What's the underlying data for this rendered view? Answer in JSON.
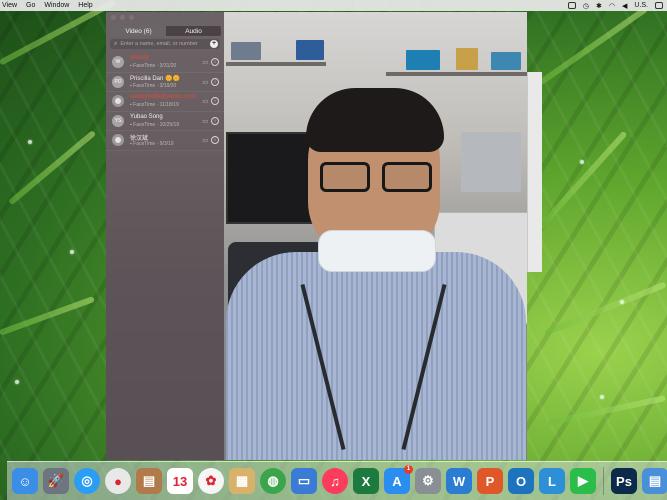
{
  "menubar": {
    "apple": "",
    "items": [
      "View",
      "Go",
      "Window",
      "Help"
    ],
    "right_status": "U.S."
  },
  "facetime": {
    "tabs": {
      "video": "Video (6)",
      "audio": "Audio"
    },
    "search_placeholder": "Enter a name, email, or number",
    "add_label": "+",
    "contacts": [
      {
        "avatar": "W",
        "name": "Wendy",
        "name_red": true,
        "sub": "FaceTime · 3/31/20"
      },
      {
        "avatar": "PD",
        "name": "Priscilla Dan 🌼🌼",
        "name_red": false,
        "sub": "FaceTime · 3/19/20"
      },
      {
        "avatar": "",
        "name": "wendyfw88@yahoo.com",
        "name_red": true,
        "sub": "FaceTime · 11/18/19"
      },
      {
        "avatar": "YS",
        "name": "Yubao Song",
        "name_red": false,
        "sub": "FaceTime · 10/25/19"
      },
      {
        "avatar": "",
        "name": "徐汉斌",
        "name_red": false,
        "sub": "FaceTime · 9/3/19"
      }
    ]
  },
  "dock": {
    "apps": [
      {
        "name": "Finder",
        "icon": "finder-icon",
        "color": "#3a8ee6",
        "glyph": "☺"
      },
      {
        "name": "Launchpad",
        "icon": "rocket-icon",
        "color": "#6d7680",
        "glyph": "🚀"
      },
      {
        "name": "Safari",
        "icon": "compass-icon",
        "color": "#2a9df4",
        "glyph": "◎"
      },
      {
        "name": "Chrome",
        "icon": "chrome-icon",
        "color": "#e8e8e8",
        "glyph": "●"
      },
      {
        "name": "Notefile",
        "icon": "notebook-icon",
        "color": "#b07a4a",
        "glyph": "▤"
      },
      {
        "name": "Calendar",
        "icon": "calendar-icon",
        "color": "#ffffff",
        "glyph": "13"
      },
      {
        "name": "Photos",
        "icon": "photos-icon",
        "color": "#f5f5f5",
        "glyph": "✿"
      },
      {
        "name": "Preview",
        "icon": "preview-icon",
        "color": "#d8b16a",
        "glyph": "▦"
      },
      {
        "name": "Globe",
        "icon": "globe-icon",
        "color": "#3aa54a",
        "glyph": "◍"
      },
      {
        "name": "Keynote",
        "icon": "keynote-icon",
        "color": "#3a7bd5",
        "glyph": "▭"
      },
      {
        "name": "Music",
        "icon": "music-icon",
        "color": "#fb3c5c",
        "glyph": "♫"
      },
      {
        "name": "Excel",
        "icon": "excel-icon",
        "color": "#1d7a3e",
        "glyph": "X"
      },
      {
        "name": "App Store",
        "icon": "appstore-icon",
        "color": "#2a8df0",
        "glyph": "A",
        "badge": "1"
      },
      {
        "name": "System Preferences",
        "icon": "gear-icon",
        "color": "#8a8f96",
        "glyph": "⚙"
      },
      {
        "name": "Word",
        "icon": "word-icon",
        "color": "#2b7cd3",
        "glyph": "W"
      },
      {
        "name": "PowerPoint",
        "icon": "powerpoint-icon",
        "color": "#e0582a",
        "glyph": "P"
      },
      {
        "name": "Outlook",
        "icon": "outlook-icon",
        "color": "#1e73be",
        "glyph": "O"
      },
      {
        "name": "Lync",
        "icon": "lync-icon",
        "color": "#2d8fd5",
        "glyph": "L"
      },
      {
        "name": "FaceTime",
        "icon": "facetime-icon",
        "color": "#2bbd4a",
        "glyph": "▶"
      },
      {
        "name": "Photoshop",
        "icon": "photoshop-icon",
        "color": "#0c2b4a",
        "glyph": "Ps"
      },
      {
        "name": "Downloads",
        "icon": "downloads-icon",
        "color": "#4a90d9",
        "glyph": "▤"
      }
    ]
  }
}
